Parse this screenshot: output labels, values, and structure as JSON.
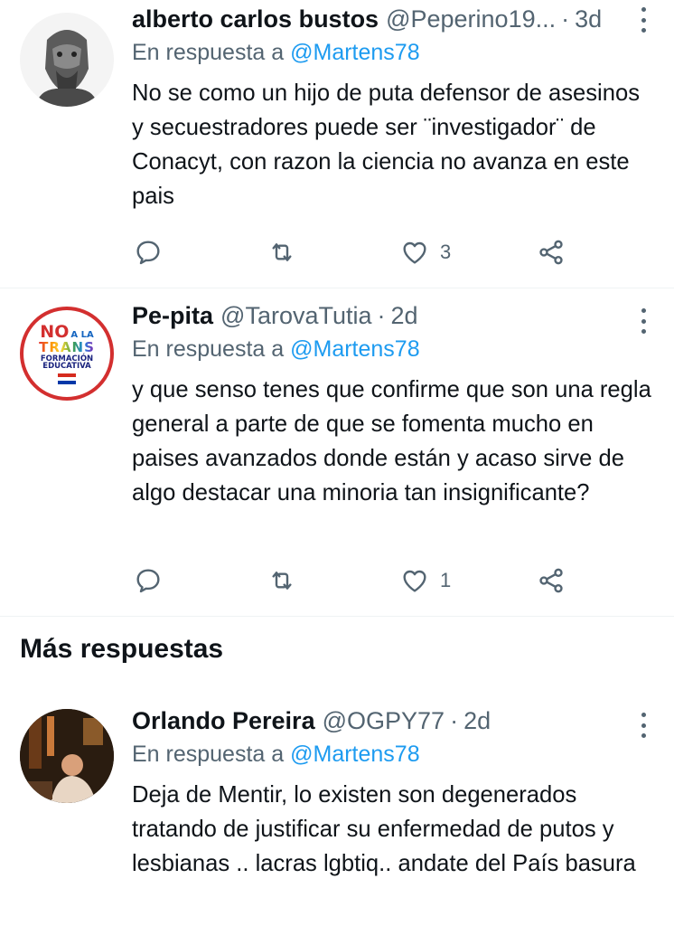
{
  "tweets": [
    {
      "name": "alberto carlos bustos",
      "handle": "@Peperino19...",
      "dot": "·",
      "time": "3d",
      "reply_prefix": "En respuesta a",
      "reply_mention": "@Martens78",
      "text": "No se como un hijo de puta defensor de asesinos y secuestradores puede ser ¨investigador¨ de Conacyt, con razon la ciencia no avanza en este pais",
      "likes": "3"
    },
    {
      "name": "Pe-pita",
      "handle": "@TarovaTutia",
      "dot": "·",
      "time": "2d",
      "reply_prefix": "En respuesta a",
      "reply_mention": "@Martens78",
      "text": "y que senso tenes que confirme que son una regla general a parte de que se fomenta mucho en paises avanzados donde están y acaso sirve de algo destacar una minoria tan insignificante?",
      "likes": "1",
      "avatar_badge": {
        "line1": "NO",
        "line1b": "A LA",
        "line2": "TRANS",
        "line3": "FORMACIÓN",
        "line4": "EDUCATIVA"
      }
    },
    {
      "name": "Orlando Pereira",
      "handle": "@OGPY77",
      "dot": "·",
      "time": "2d",
      "reply_prefix": "En respuesta a",
      "reply_mention": "@Martens78",
      "text": "Deja de Mentir,  lo existen son degenerados tratando de justificar su enfermedad de putos y lesbianas .. lacras lgbtiq.. andate del País basura"
    }
  ],
  "section_title": "Más respuestas",
  "icons": {
    "reply": "reply-icon",
    "retweet": "retweet-icon",
    "like": "heart-icon",
    "share": "share-icon",
    "more": "more-options-icon"
  },
  "colors": {
    "text": "#0f1419",
    "secondary": "#536471",
    "link": "#1d9bf0",
    "divider": "#eff3f4"
  }
}
